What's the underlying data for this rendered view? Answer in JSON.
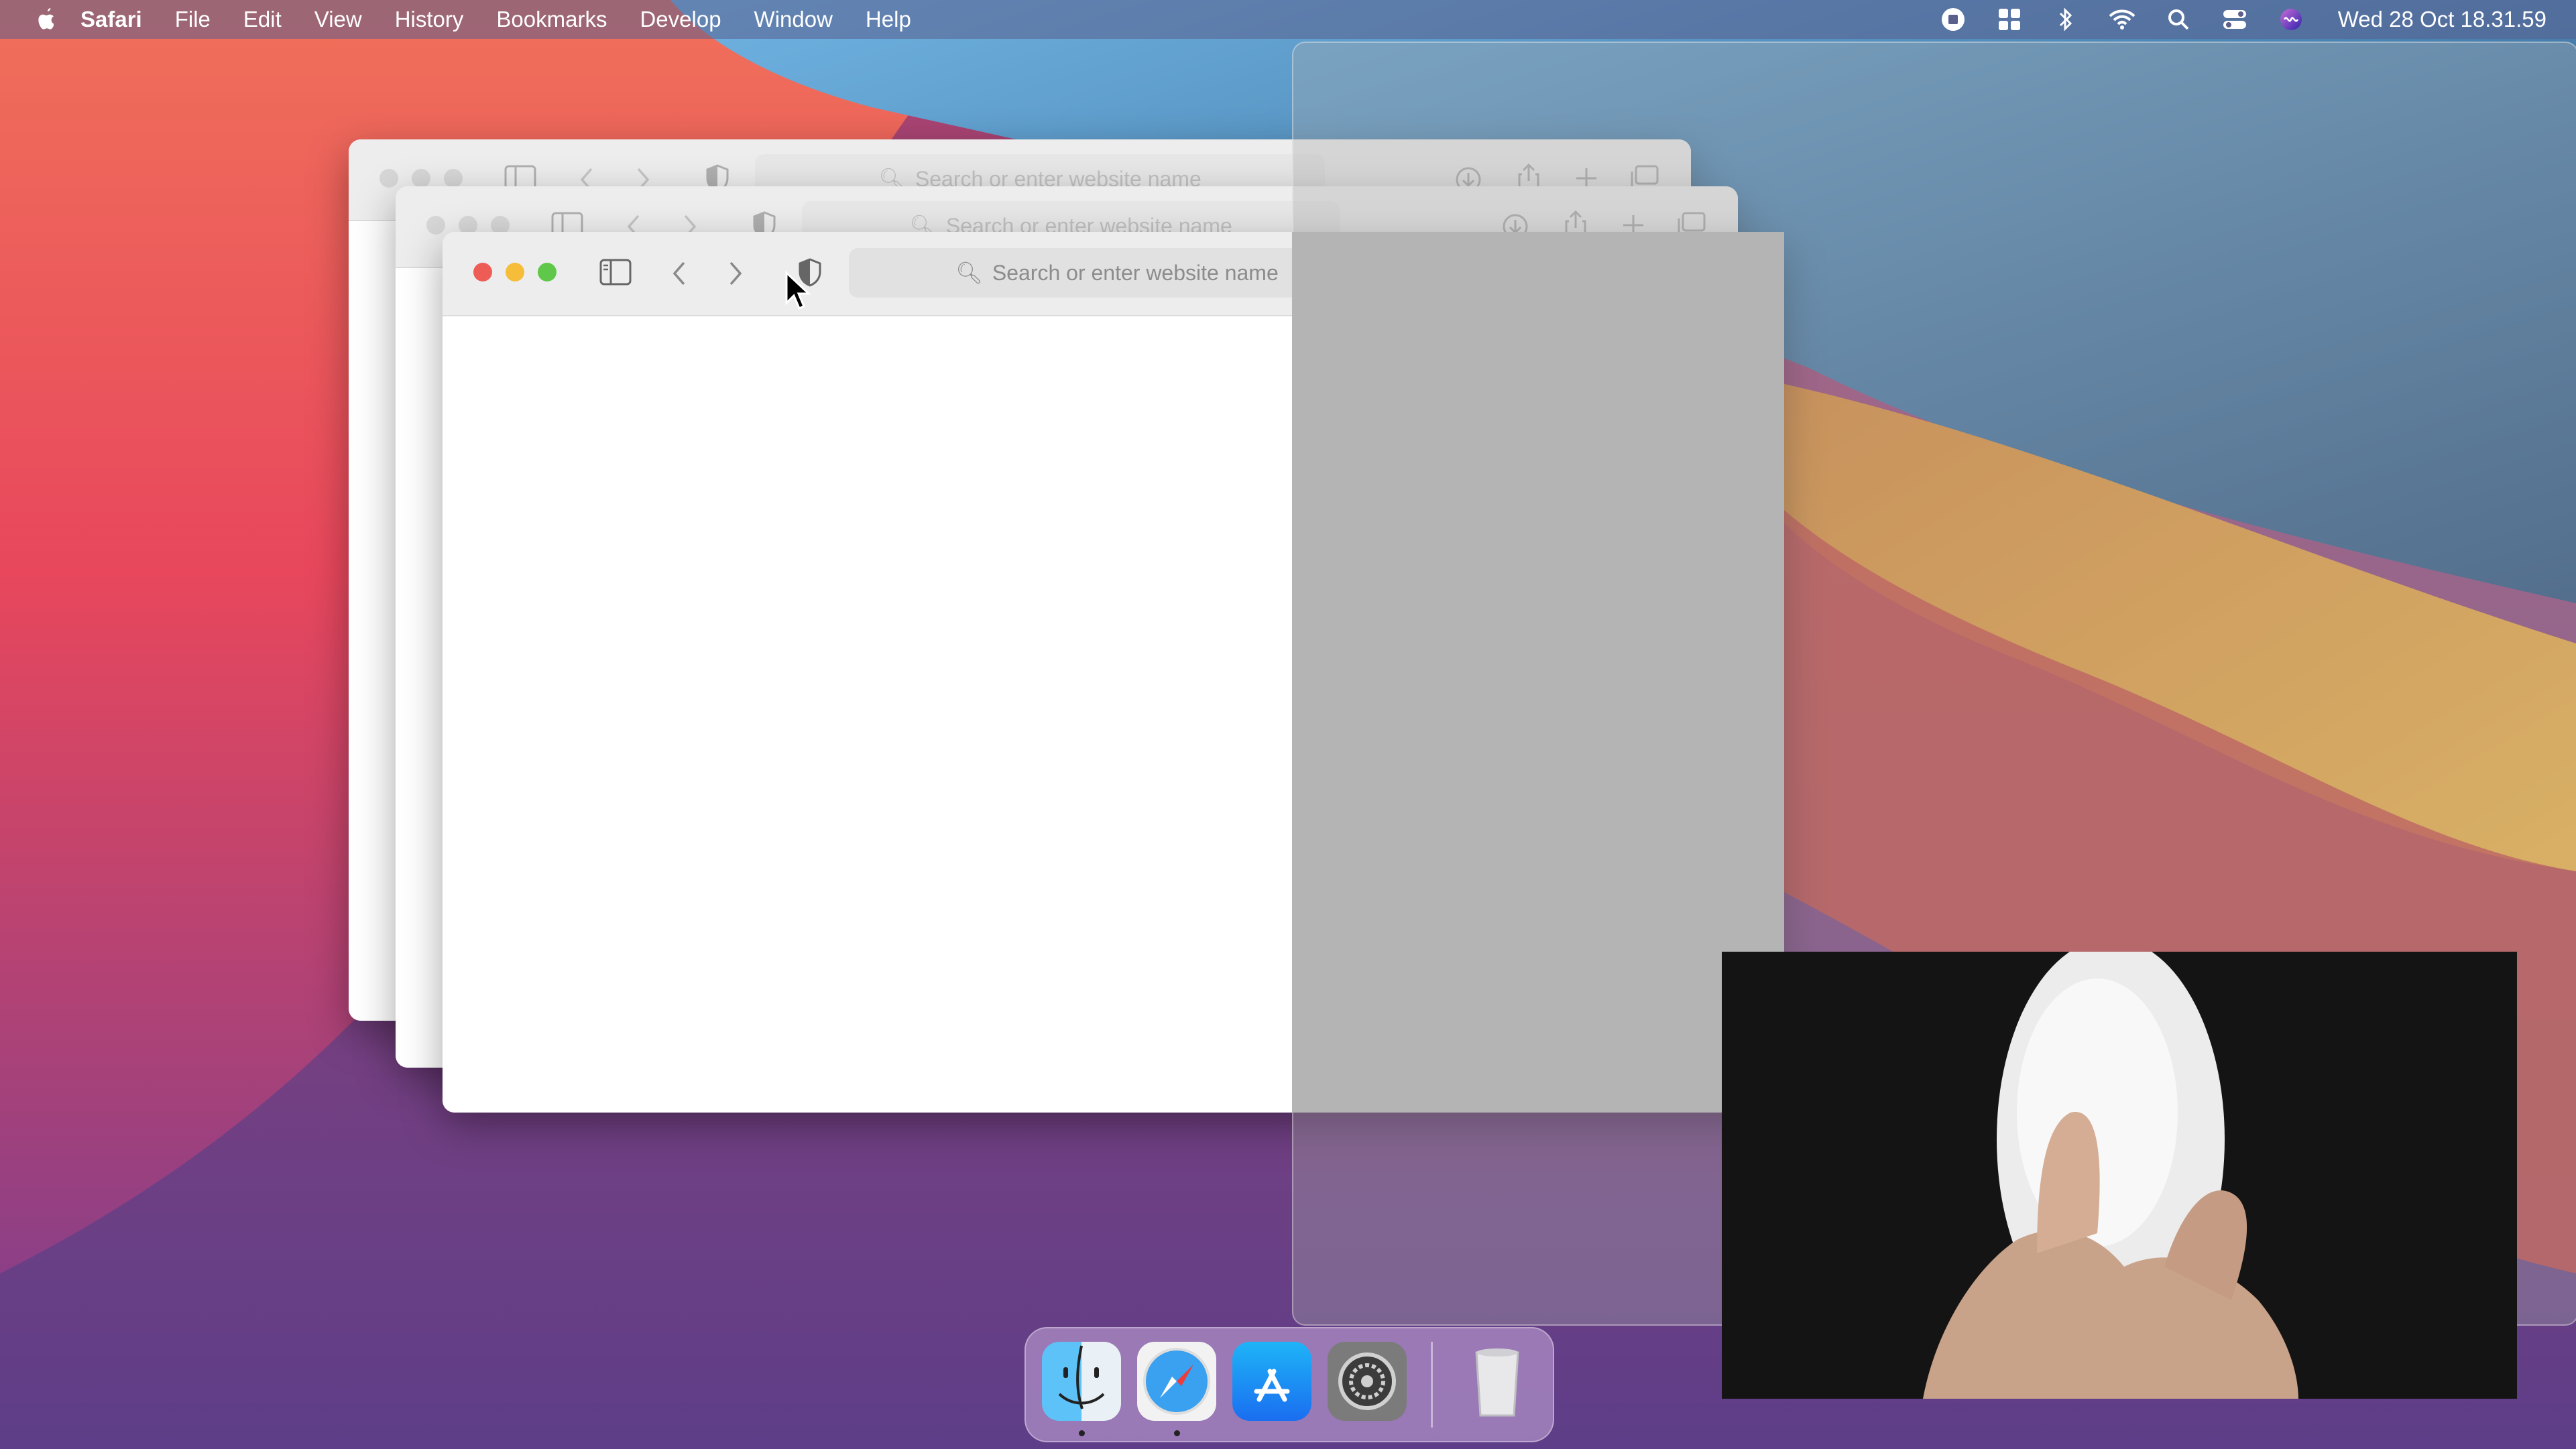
{
  "menubar": {
    "app_name": "Safari",
    "items": [
      "File",
      "Edit",
      "View",
      "History",
      "Bookmarks",
      "Develop",
      "Window",
      "Help"
    ],
    "status_icons": [
      "record-icon",
      "grid-icon",
      "bluetooth-icon",
      "wifi-icon",
      "search-icon",
      "control-center-icon",
      "siri-icon"
    ],
    "clock": "Wed 28 Oct  18.31.59"
  },
  "windows": {
    "back": {
      "search_placeholder": "Search or enter website name"
    },
    "middle": {
      "search_placeholder": "Search or enter website name"
    },
    "front": {
      "search_placeholder": "Search or enter website name"
    }
  },
  "dock": {
    "apps": [
      "finder-icon",
      "safari-icon",
      "app-store-icon",
      "system-preferences-icon",
      "trash-icon"
    ]
  },
  "colors": {
    "close": "#ed5d56",
    "minimize": "#f6bd3b",
    "zoom": "#5fc84a",
    "menubar_text": "#ffffff"
  }
}
